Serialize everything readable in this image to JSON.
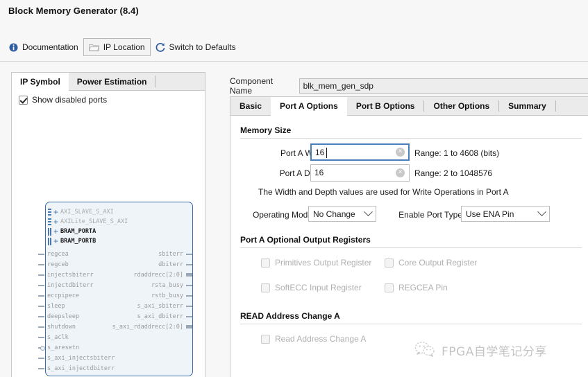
{
  "app": {
    "title": "Block Memory Generator (8.4)"
  },
  "toolbar": {
    "items": [
      {
        "label": "Documentation",
        "icon": "info-icon",
        "boxed": false
      },
      {
        "label": "IP Location",
        "icon": "folder-icon",
        "boxed": true
      },
      {
        "label": "Switch to Defaults",
        "icon": "refresh-icon",
        "boxed": false
      }
    ]
  },
  "left_panel": {
    "tabs": [
      {
        "label": "IP Symbol",
        "active": true
      },
      {
        "label": "Power Estimation",
        "active": false
      }
    ],
    "show_disabled_ports": {
      "label": "Show disabled ports",
      "checked": true
    },
    "ip_symbol": {
      "buses": [
        {
          "label": "AXI_SLAVE_S_AXI",
          "enabled": false,
          "grip": "dotted"
        },
        {
          "label": "AXILite_SLAVE_S_AXI",
          "enabled": false,
          "grip": "dotted"
        },
        {
          "label": "BRAM_PORTA",
          "enabled": true,
          "grip": "solid"
        },
        {
          "label": "BRAM_PORTB",
          "enabled": true,
          "grip": "solid"
        }
      ],
      "left_pins": [
        {
          "label": "regcea",
          "stub": "thin"
        },
        {
          "label": "regceb",
          "stub": "thin"
        },
        {
          "label": "injectsbiterr",
          "stub": "thin"
        },
        {
          "label": "injectdbiterr",
          "stub": "thin"
        },
        {
          "label": "eccpipece",
          "stub": "thin"
        },
        {
          "label": "sleep",
          "stub": "thin"
        },
        {
          "label": "deepsleep",
          "stub": "thin"
        },
        {
          "label": "shutdown",
          "stub": "thin"
        },
        {
          "label": "s_aclk",
          "stub": "thin"
        },
        {
          "label": "s_aresetn",
          "stub": "inverted"
        },
        {
          "label": "s_axi_injectsbiterr",
          "stub": "thin"
        },
        {
          "label": "s_axi_injectdbiterr",
          "stub": "thin"
        }
      ],
      "right_pins": [
        {
          "label": "sbiterr",
          "stub": "thin"
        },
        {
          "label": "dbiterr",
          "stub": "thin"
        },
        {
          "label": "rdaddrecc[2:0]",
          "stub": "thick"
        },
        {
          "label": "rsta_busy",
          "stub": "thin"
        },
        {
          "label": "rstb_busy",
          "stub": "thin"
        },
        {
          "label": "s_axi_sbiterr",
          "stub": "thin"
        },
        {
          "label": "s_axi_dbiterr",
          "stub": "thin"
        },
        {
          "label": "s_axi_rdaddrecc[2:0]",
          "stub": "thick"
        }
      ]
    }
  },
  "right_panel": {
    "component_name": {
      "label": "Component Name",
      "value": "blk_mem_gen_sdp",
      "placeholder": "Component Name"
    },
    "tabs": [
      {
        "label": "Basic",
        "active": false
      },
      {
        "label": "Port A Options",
        "active": true
      },
      {
        "label": "Port B Options",
        "active": false
      },
      {
        "label": "Other Options",
        "active": false
      },
      {
        "label": "Summary",
        "active": false
      }
    ],
    "memory_size": {
      "section_title": "Memory Size",
      "port_a_width": {
        "label": "Port A Width",
        "value": "16",
        "placeholder": "",
        "range": "Range: 1 to 4608 (bits)",
        "focused": true
      },
      "port_a_depth": {
        "label": "Port A Depth",
        "value": "16",
        "placeholder": "",
        "range": "Range: 2 to 1048576",
        "focused": false
      },
      "note": "The Width and Depth values are used for Write Operations in Port A",
      "operating_mode": {
        "label": "Operating Mode",
        "value": "No Change"
      },
      "enable_port_type": {
        "label": "Enable Port Type",
        "value": "Use ENA Pin"
      }
    },
    "optional_output_registers": {
      "section_title": "Port A Optional Output Registers",
      "checkboxes": [
        {
          "label": "Primitives Output Register",
          "checked": false,
          "disabled": true
        },
        {
          "label": "Core Output Register",
          "checked": false,
          "disabled": true
        },
        {
          "label": "SoftECC Input Register",
          "checked": false,
          "disabled": true
        },
        {
          "label": "REGCEA Pin",
          "checked": false,
          "disabled": true
        }
      ]
    },
    "read_address_change": {
      "section_title": "READ Address Change A",
      "checkbox": {
        "label": "Read Address Change A",
        "checked": false,
        "disabled": true
      }
    }
  },
  "watermark": {
    "text": "FPGA自学笔记分享",
    "icon": "wechat-icon"
  },
  "colors": {
    "accent": "#4a7ebb",
    "symbol_border": "#3b6ea5",
    "symbol_fill": "#eff4f9",
    "disabled_text": "#b0b0b0"
  }
}
